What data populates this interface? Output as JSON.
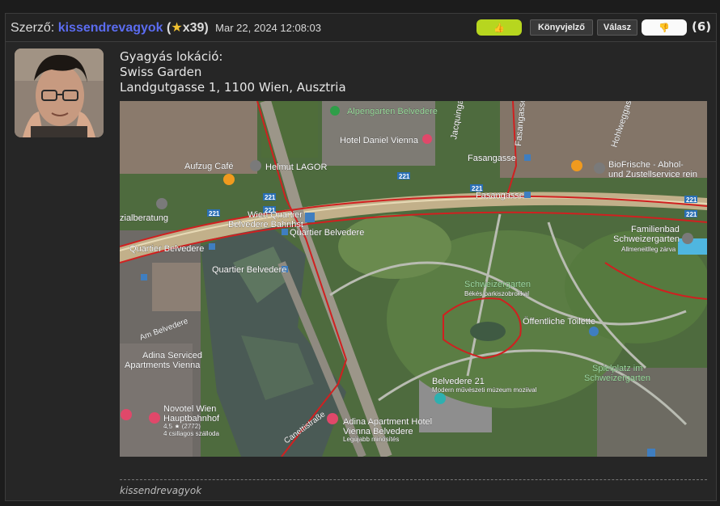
{
  "header": {
    "author_prefix": "Szerző:",
    "author_name": "kissendrevagyok",
    "rank_open": "(",
    "rank_icon": "star-icon",
    "rank_value": "x39",
    "rank_close": ")",
    "date": "Mar 22, 2024 12:08:03",
    "bookmark_label": "Könyvjelző",
    "reply_label": "Válasz",
    "like_count": "(6)"
  },
  "post": {
    "line1": "Gyagyás lokáció:",
    "line2": "Swiss Garden",
    "line3": "Landgutgasse 1, 1100 Wien, Ausztria"
  },
  "map": {
    "labels": {
      "alpengarten": "Alpengarten Belvedere",
      "hotel_daniel": "Hotel Daniel Vienna",
      "aufzug": "Aufzug Café",
      "helmut": "Helmut LAGOR",
      "fasangasse_top": "Fasangasse",
      "fasangasse_mid": "Fasangasse",
      "jacquingasse": "Jacquingasse",
      "fasangasse_vertical": "Fasangasse",
      "hohlweggasse": "Hohlweggasse",
      "biofrische1": "BioFrische - Abhol-",
      "biofrische2": "und Zustellservice rein",
      "familienbad1": "Familienbad",
      "familienbad2": "Schweizergarten",
      "familienbad3": "Allmeneitlleg zárva",
      "sozialberatung": "zialberatung",
      "wien_quartier1": "Wien Quartier",
      "wien_quartier2": "Belvedere Bahnhst",
      "quartier_belvedere1": "Quartier Belvedere",
      "quartier_belvedere2": "Quartier Belvedere",
      "quartier_belvedere3": "Quartier Belvedere",
      "schweizergarten": "Schweizergarten",
      "schweizergarten_sub": "Békés parkiszobrokkal",
      "toilette": "Öffentliche Toilette",
      "am_belvedere": "Am Belvedere",
      "adina1": "Adina Serviced",
      "adina2": "Apartments Vienna",
      "belvedere21": "Belvedere 21",
      "belvedere21_sub": "Modern művészeti múzeum moziival",
      "spielplatz1": "Spielplatz im",
      "spielplatz2": "Schweizergarten",
      "novotel1": "Novotel Wien",
      "novotel2": "Hauptbahnhof",
      "novotel3": "4,5 ★ (2772)",
      "novotel4": "4 csillagos szálloda",
      "adina_apt1": "Adina Apartment Hotel",
      "adina_apt2": "Vienna Belvedere",
      "adina_apt3": "Legújabb minősítés",
      "canettistrasse": "Canettistraße",
      "bus_221a": "221",
      "bus_221b": "221",
      "bus_221c": "221",
      "bus_221d": "221",
      "bus_221e": "221",
      "bus_221f": "221",
      "bus_221g": "221"
    }
  },
  "signature": "kissendrevagyok"
}
